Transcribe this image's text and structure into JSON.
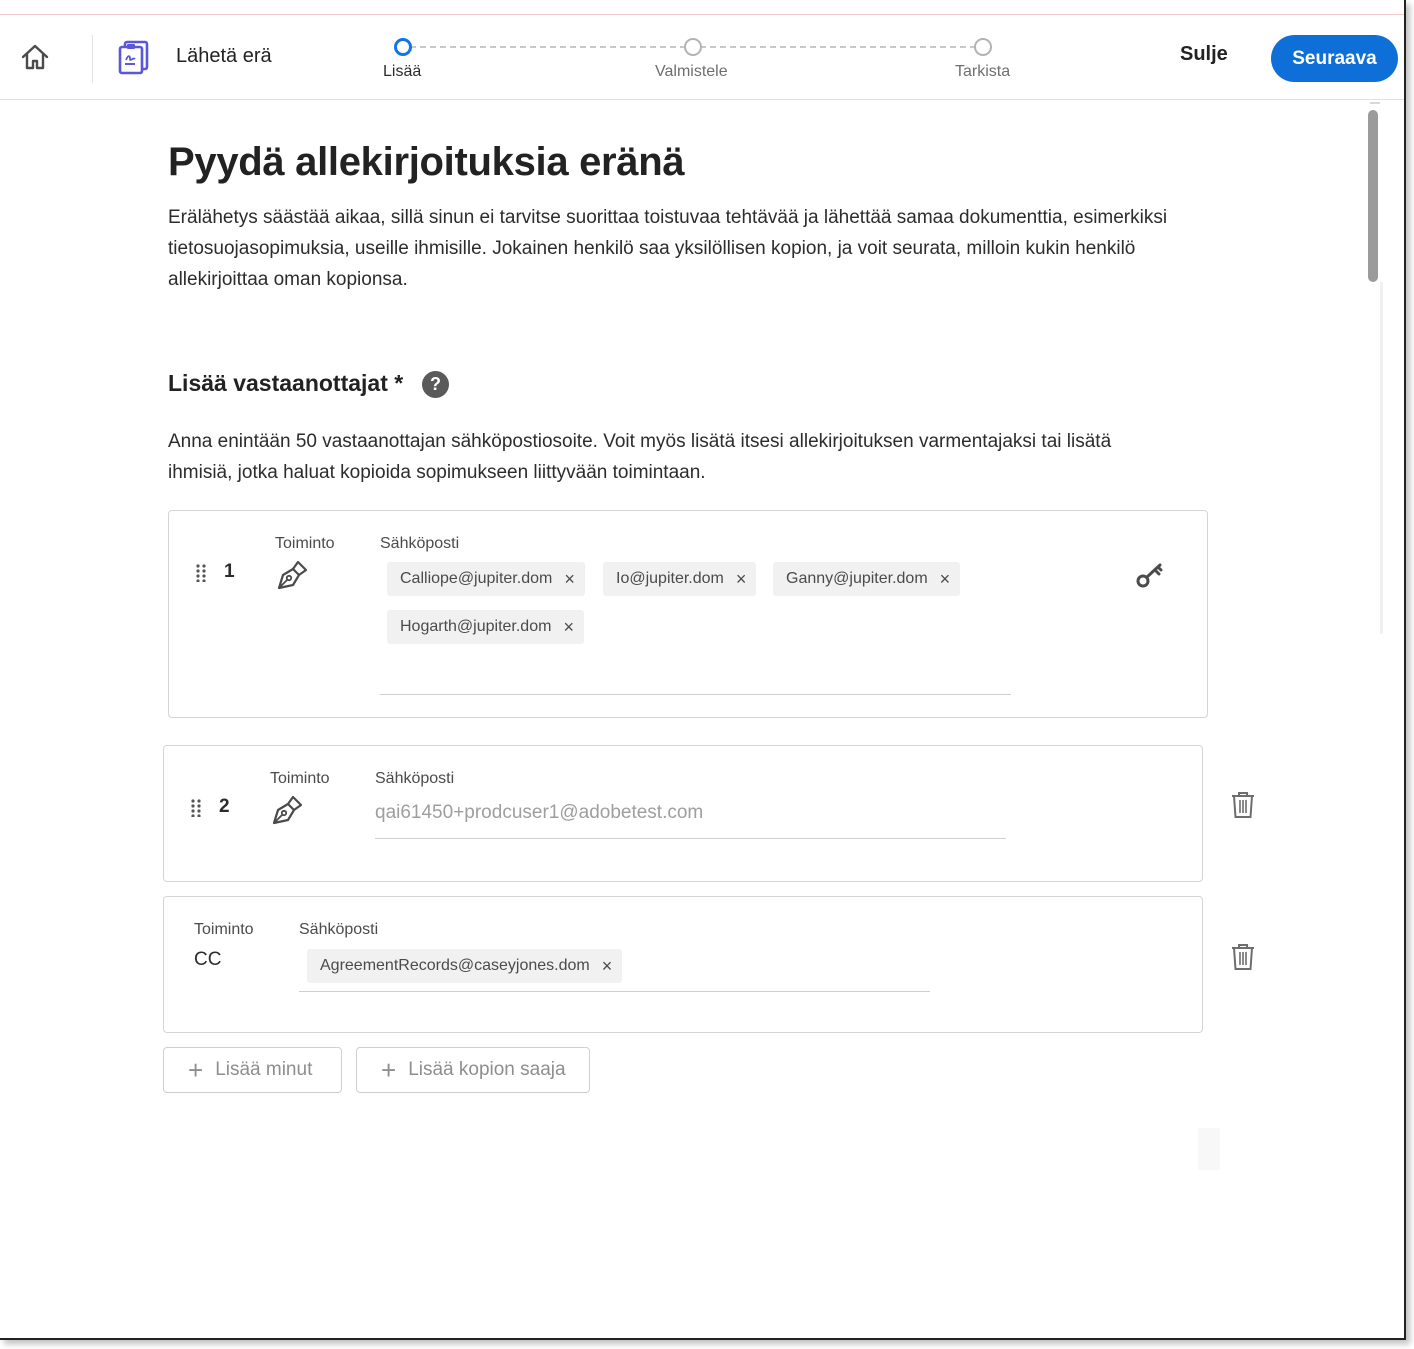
{
  "header": {
    "title": "Lähetä erä",
    "steps": [
      {
        "label": "Lisää",
        "active": true
      },
      {
        "label": "Valmistele",
        "active": false
      },
      {
        "label": "Tarkista",
        "active": false
      }
    ],
    "close_label": "Sulje",
    "next_label": "Seuraava",
    "accent_color": "#0f6fd8"
  },
  "main": {
    "title": "Pyydä allekirjoituksia eränä",
    "intro": "Erälähetys säästää aikaa, sillä sinun ei tarvitse suorittaa toistuvaa tehtävää ja lähettää samaa dokumenttia, esimerkiksi tietosuojasopimuksia, useille ihmisille. Jokainen henkilö saa yksilöllisen kopion, ja voit seurata, milloin kukin henkilö allekirjoittaa oman kopionsa.",
    "section_title": "Lisää vastaanottajat *",
    "help_icon": "?",
    "section_desc": "Anna enintään 50 vastaanottajan sähköpostiosoite. Voit myös lisätä itsesi allekirjoituksen varmentajaksi tai lisätä ihmisiä, jotka haluat kopioida sopimukseen liittyvään toimintaan."
  },
  "recipients": [
    {
      "number": "1",
      "action_label": "Toiminto",
      "email_label": "Sähköposti",
      "action_icon": "pen-icon",
      "chips": [
        "Calliope@jupiter.dom",
        "Io@jupiter.dom",
        "Ganny@jupiter.dom",
        "Hogarth@jupiter.dom"
      ],
      "side_icon": "key-icon"
    },
    {
      "number": "2",
      "action_label": "Toiminto",
      "email_label": "Sähköposti",
      "action_icon": "pen-icon",
      "placeholder": "qai61450+prodcuser1@adobetest.com",
      "side_icon": "trash-icon"
    },
    {
      "action_label": "Toiminto",
      "email_label": "Sähköposti",
      "action_value": "CC",
      "chips": [
        "AgreementRecords@caseyjones.dom"
      ],
      "side_icon": "trash-icon"
    }
  ],
  "buttons": {
    "add_me": "Lisää minut",
    "add_cc": "Lisää kopion saaja"
  }
}
